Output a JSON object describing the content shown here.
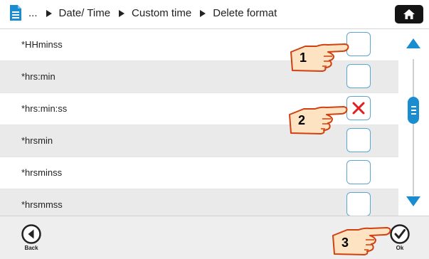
{
  "header": {
    "breadcrumb": {
      "ellipsis": "...",
      "items": [
        "Date/ Time",
        "Custom time",
        "Delete format"
      ]
    },
    "doc_icon": "document-icon",
    "home_icon": "home-icon"
  },
  "rows": [
    {
      "label": "*HHminss",
      "checked": false
    },
    {
      "label": "*hrs:min",
      "checked": false
    },
    {
      "label": "*hrs:min:ss",
      "checked": true
    },
    {
      "label": "*hrsmin",
      "checked": false
    },
    {
      "label": "*hrsminss",
      "checked": false
    },
    {
      "label": "*hrsmmss",
      "checked": false
    }
  ],
  "scrollbar": {
    "up_icon": "arrow-up-icon",
    "down_icon": "arrow-down-icon"
  },
  "footer": {
    "back_label": "Back",
    "ok_label": "Ok"
  },
  "callouts": [
    "1",
    "2",
    "3"
  ],
  "colors": {
    "accent": "#1a8cd0",
    "checkbox_border": "#5aa6d0",
    "check_mark": "#e02020",
    "callout_fill": "#fde3c2",
    "callout_stroke": "#d04010"
  }
}
